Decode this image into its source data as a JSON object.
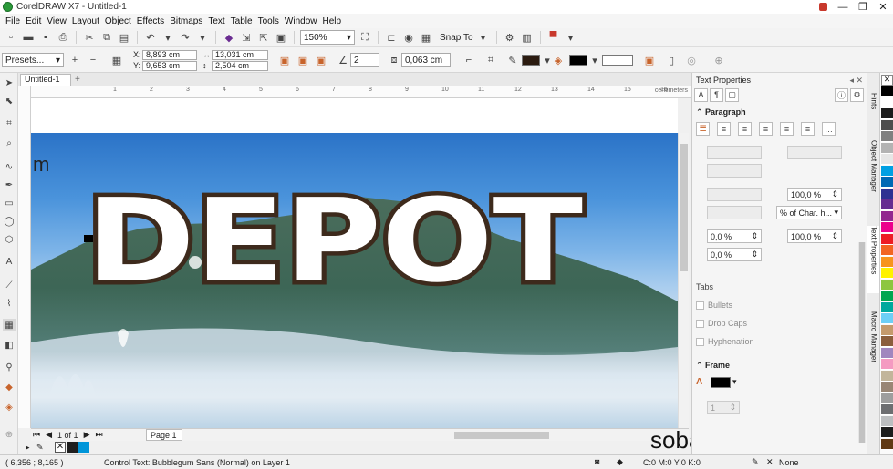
{
  "window": {
    "title": "CorelDRAW X7 - Untitled-1"
  },
  "menu": [
    "File",
    "Edit",
    "View",
    "Layout",
    "Object",
    "Effects",
    "Bitmaps",
    "Text",
    "Table",
    "Tools",
    "Window",
    "Help"
  ],
  "toolbar": {
    "zoom": "150%",
    "snap_to": "Snap To"
  },
  "propbar": {
    "presets": "Presets...",
    "x_label": "X:",
    "x": "8,893 cm",
    "y_label": "Y:",
    "y": "9,653 cm",
    "width": "13,031 cm",
    "height": "2,504 cm",
    "angle": "2",
    "outline_width": "0,063 cm"
  },
  "document": {
    "tab": "Untitled-1",
    "units": "centimeters",
    "ruler_ticks": [
      "1",
      "2",
      "3",
      "4",
      "5",
      "6",
      "7",
      "8",
      "9",
      "10",
      "11",
      "12",
      "13",
      "14",
      "15",
      "16",
      "17"
    ],
    "canvas_text": "DEPOT",
    "cut_text": "m",
    "page_counter": "1 of 1",
    "page_tab": "Page 1"
  },
  "docker": {
    "title": "Text Properties",
    "paragraph": {
      "heading": "Paragraph",
      "line_spacing": "100,0 %",
      "spacing_unit": "% of Char. h...",
      "char_spacing": "0,0 %",
      "word_spacing": "100,0 %",
      "lang_spacing": "0,0 %"
    },
    "tabs_label": "Tabs",
    "bullets_label": "Bullets",
    "dropcaps_label": "Drop Caps",
    "hyphenation_label": "Hyphenation",
    "frame": {
      "heading": "Frame",
      "columns": "1"
    }
  },
  "sidetabs": [
    "Hints",
    "Object Manager",
    "Text Properties",
    "Macro Manager"
  ],
  "statusbar": {
    "coords": "( 6,356 ; 8,165 )",
    "info": "Control Text: Bubblegum Sans (Normal) on Layer 1",
    "fill_values": "C:0 M:0 Y:0 K:0",
    "outline": "None"
  },
  "watermark": "sobat-tutorial.com",
  "colors": {
    "palette": [
      "#000000",
      "#ffffff",
      "#1a1a1a",
      "#4d4d4d",
      "#808080",
      "#b3b3b3",
      "#e6e6e6",
      "#00a0e3",
      "#0069b4",
      "#2e3192",
      "#662d91",
      "#92278f",
      "#ec008c",
      "#ed1c24",
      "#f26522",
      "#f7941d",
      "#fff200",
      "#8dc63f",
      "#00a651",
      "#00a99d",
      "#6dcff6",
      "#c49a6c",
      "#8b5e3c",
      "#a186be",
      "#f49ac1",
      "#c2b59b",
      "#998675",
      "#9e9e9e",
      "#6d6e71",
      "#bcbec0",
      "#1d1d1d",
      "#603913"
    ]
  }
}
